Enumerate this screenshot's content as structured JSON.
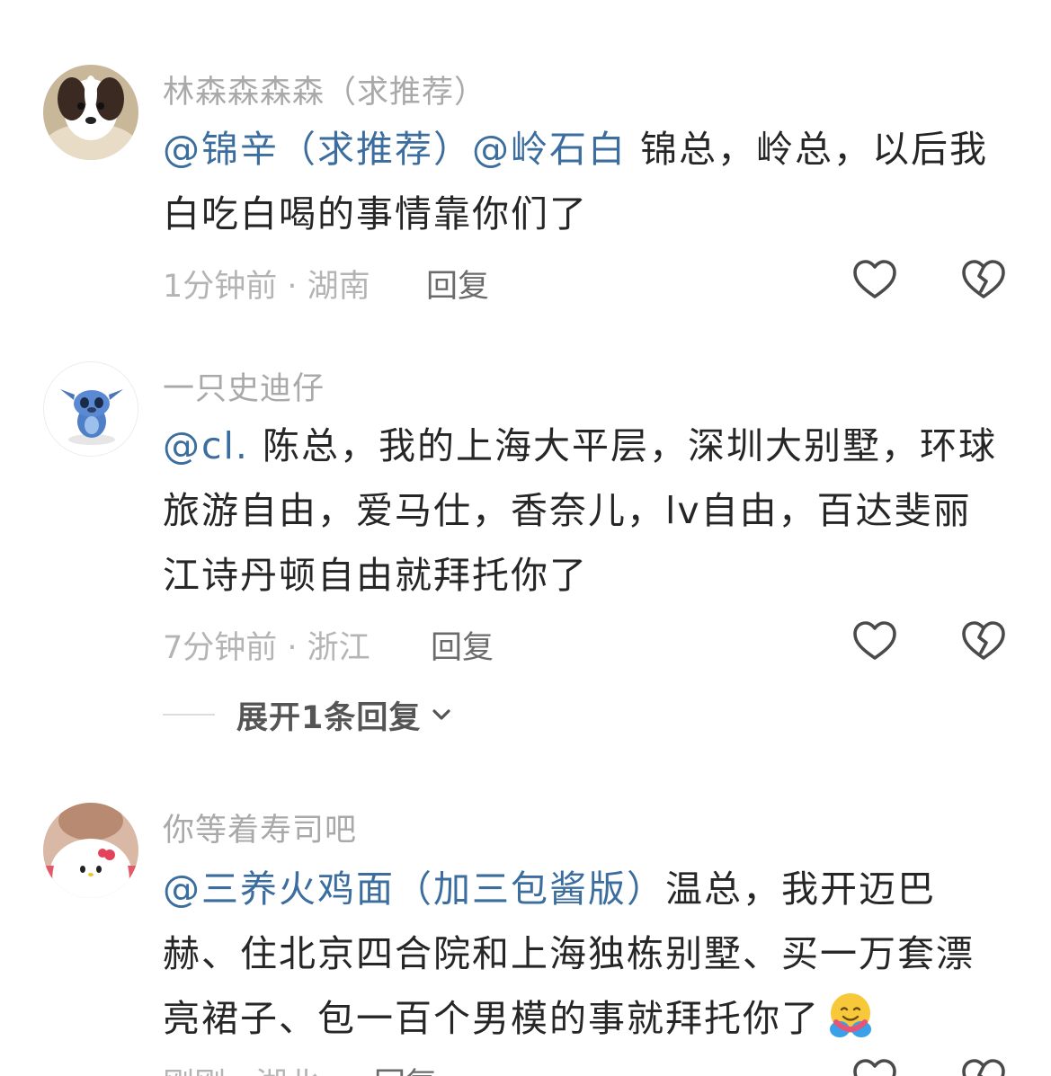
{
  "comments": [
    {
      "username": "林森森森森（求推荐）",
      "mention1": "@锦辛（求推荐）@岭石白",
      "text": " 锦总，岭总，以后我白吃白喝的事情靠你们了",
      "time_location": "1分钟前 · 湖南",
      "reply_label": "回复",
      "avatar_icon": "dog-avatar-icon"
    },
    {
      "username": "一只史迪仔",
      "mention1": "@cl.",
      "text": " 陈总，我的上海大平层，深圳大别墅，环球旅游自由，爱马仕，香奈儿，lv自由，百达斐丽江诗丹顿自由就拜托你了",
      "time_location": "7分钟前 · 浙江",
      "reply_label": "回复",
      "expand_label": "展开1条回复",
      "avatar_icon": "stitch-avatar-icon"
    },
    {
      "username": "你等着寿司吧",
      "mention1": "@三养火鸡面（加三包酱版）",
      "text": "温总，我开迈巴赫、住北京四合院和上海独栋别墅、买一万套漂亮裙子、包一百个男模的事就拜托你了",
      "time_location": "刚刚 · 湖北",
      "reply_label": "回复",
      "avatar_icon": "hello-kitty-avatar-icon"
    }
  ],
  "colors": {
    "mention": "#3b6d9e",
    "username": "#a9a9a9",
    "meta": "#b4b4b4",
    "text": "#262626"
  }
}
